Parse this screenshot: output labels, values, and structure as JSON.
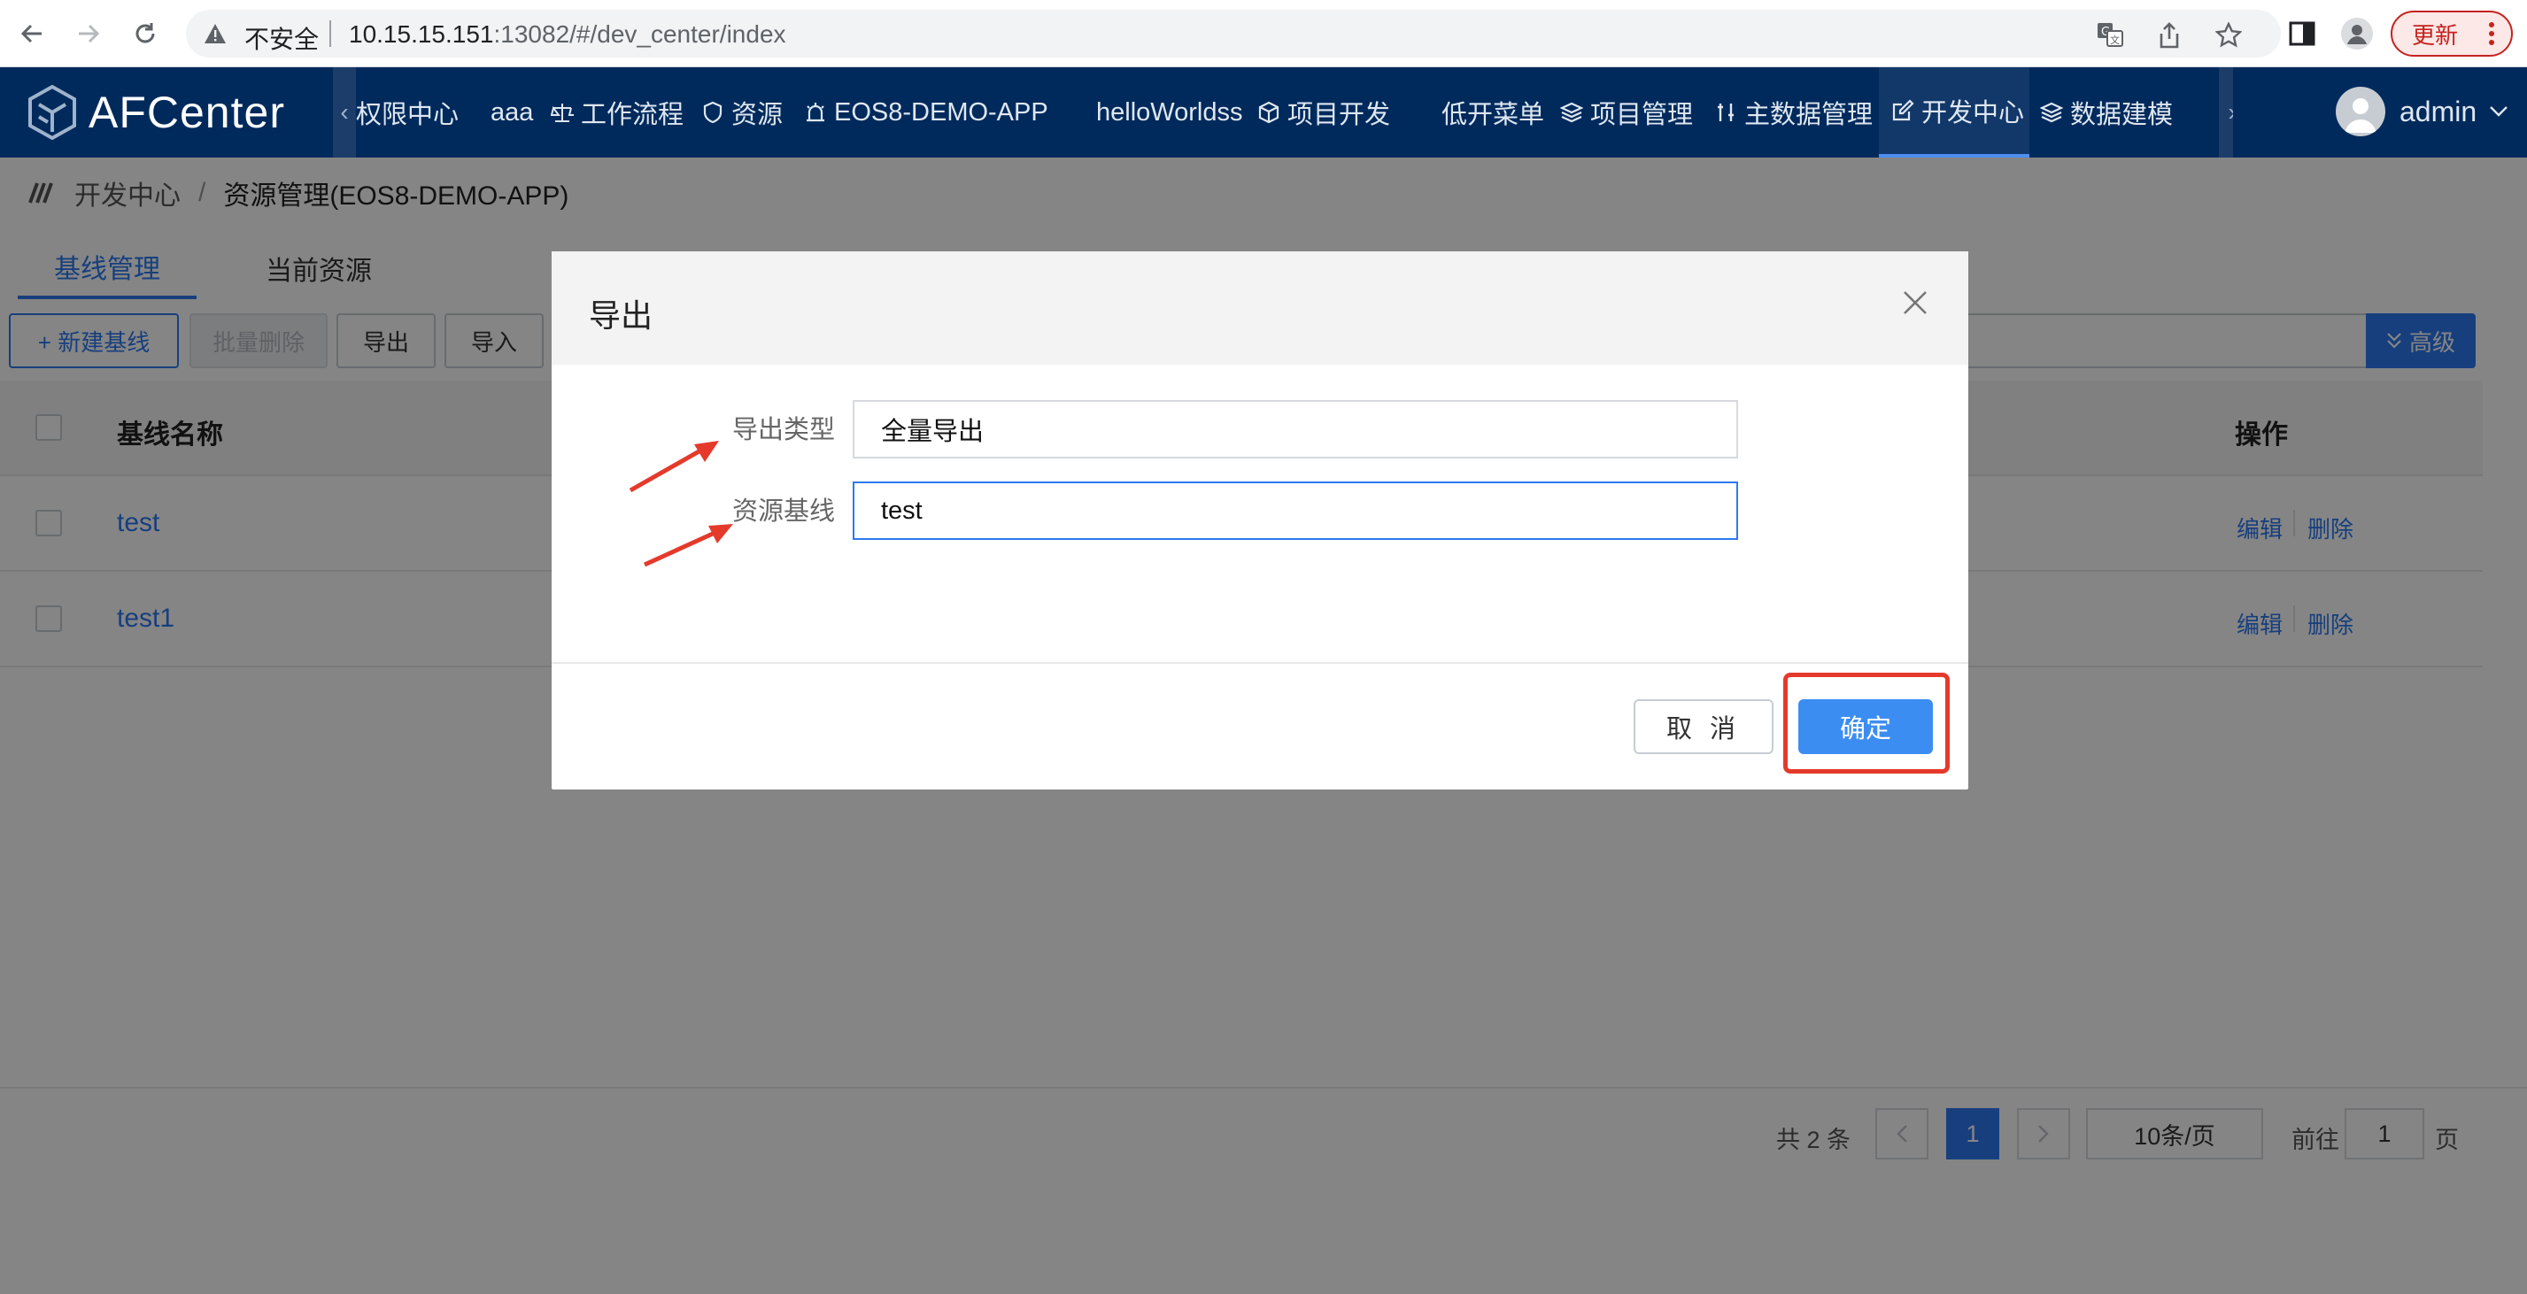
{
  "browser": {
    "insecure_label": "不安全",
    "url_host": "10.15.15.151",
    "url_rest": ":13082/#/dev_center/index",
    "update_label": "更新",
    "icons": [
      "back-icon",
      "forward-icon",
      "reload-icon",
      "warning-icon",
      "translate-icon",
      "share-icon",
      "bookmark-star-icon",
      "side-panel-icon",
      "profile-icon",
      "more-vert-icon"
    ]
  },
  "header": {
    "logo_text": "AFCenter",
    "menu_scroll_left": "‹",
    "menu_scroll_right": "›",
    "menu": [
      {
        "label": "权限中心",
        "icon": ""
      },
      {
        "label": "aaa",
        "icon": ""
      },
      {
        "label": "工作流程",
        "icon": "scale-icon"
      },
      {
        "label": "资源",
        "icon": "shield-icon"
      },
      {
        "label": "EOS8-DEMO-APP",
        "icon": "alarm-icon"
      },
      {
        "label": "helloWorldss",
        "icon": ""
      },
      {
        "label": "项目开发",
        "icon": "cube-icon"
      },
      {
        "label": "低开菜单",
        "icon": ""
      },
      {
        "label": "项目管理",
        "icon": "layers-icon"
      },
      {
        "label": "主数据管理",
        "icon": "tools-icon"
      },
      {
        "label": "开发中心",
        "icon": "edit-icon"
      },
      {
        "label": "数据建模",
        "icon": "layers-icon"
      }
    ],
    "user": "admin"
  },
  "breadcrumb": {
    "root": "开发中心",
    "separator": "/",
    "current": "资源管理(EOS8-DEMO-APP)"
  },
  "tabs": [
    "基线管理",
    "当前资源"
  ],
  "toolbar": {
    "new_baseline": "+ 新建基线",
    "batch_delete": "批量删除",
    "export": "导出",
    "import": "导入",
    "advanced": "高级"
  },
  "table": {
    "col_name": "基线名称",
    "col_ops": "操作",
    "rows": [
      {
        "name": "test",
        "edit": "编辑",
        "delete": "删除"
      },
      {
        "name": "test1",
        "edit": "编辑",
        "delete": "删除"
      }
    ]
  },
  "pagination": {
    "total": "共 2 条",
    "current_page": "1",
    "page_size": "10条/页",
    "goto_label": "前往",
    "goto_value": "1",
    "page_suffix": "页"
  },
  "modal": {
    "title": "导出",
    "fields": [
      {
        "label": "导出类型",
        "value": "全量导出"
      },
      {
        "label": "资源基线",
        "value": "test"
      }
    ],
    "cancel": "取 消",
    "confirm": "确定"
  },
  "colors": {
    "header_bg": "#002a5c",
    "primary": "#2d79f0",
    "annotation_red": "#e53a2b"
  }
}
